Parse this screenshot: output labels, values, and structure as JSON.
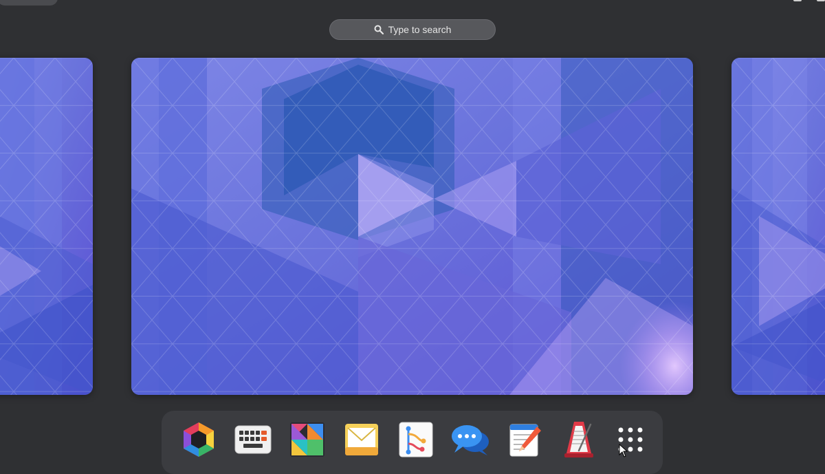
{
  "search": {
    "placeholder": "Type to search",
    "icon": "search-icon"
  },
  "workspaces": [
    {
      "name": "workspace-previous",
      "state": "partial-left"
    },
    {
      "name": "workspace-current",
      "state": "active"
    },
    {
      "name": "workspace-next",
      "state": "partial-right"
    }
  ],
  "dock": {
    "apps": [
      {
        "name": "app-hexagon-colorful",
        "icon": "hexagon-rainbow-icon"
      },
      {
        "name": "app-keyboard",
        "icon": "keyboard-icon"
      },
      {
        "name": "app-tangram",
        "icon": "tangram-icon"
      },
      {
        "name": "app-mail",
        "icon": "envelope-icon"
      },
      {
        "name": "app-git-branches",
        "icon": "git-branch-icon"
      },
      {
        "name": "app-chat",
        "icon": "chat-bubbles-icon"
      },
      {
        "name": "app-text-editor",
        "icon": "notepad-pencil-icon"
      },
      {
        "name": "app-metronome",
        "icon": "metronome-icon"
      },
      {
        "name": "app-grid",
        "icon": "show-apps-grid-icon"
      }
    ]
  },
  "colors": {
    "background": "#2f3033",
    "dock": "#3b3c40",
    "search_bg": "#57585c",
    "wallpaper_base": "#5b6ad8",
    "wallpaper_highlight": "#c7a8ff"
  }
}
